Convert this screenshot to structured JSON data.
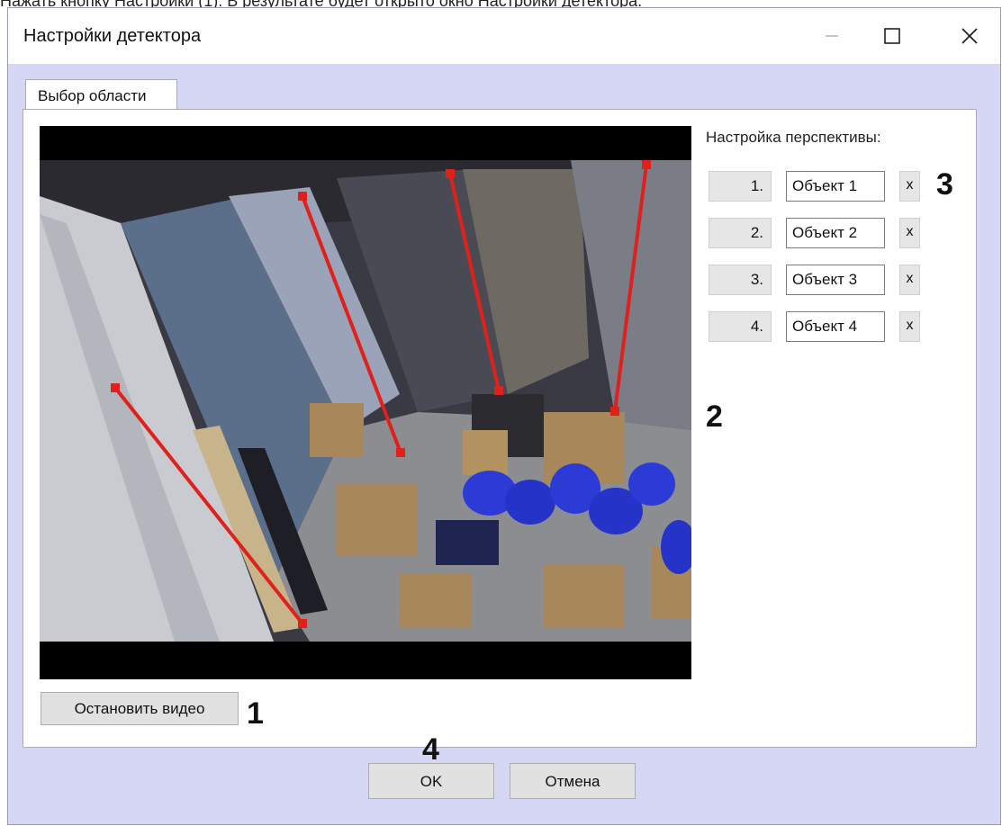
{
  "doc_text": "Нажать кнопку Настройки (1). В результате будет открыто окно Настройки детектора.",
  "window": {
    "title": "Настройки детектора"
  },
  "tab": {
    "label": "Выбор области"
  },
  "perspective": {
    "label": "Настройка перспективы:",
    "rows": [
      {
        "num": "1.",
        "name": "Объект 1",
        "delete": "x"
      },
      {
        "num": "2.",
        "name": "Объект 2",
        "delete": "x"
      },
      {
        "num": "3.",
        "name": "Объект 3",
        "delete": "x"
      },
      {
        "num": "4.",
        "name": "Объект 4",
        "delete": "x"
      }
    ]
  },
  "buttons": {
    "stop_video": "Остановить видео",
    "ok": "OK",
    "cancel": "Отмена"
  },
  "callouts": {
    "c1": "1",
    "c2": "2",
    "c3": "3",
    "c4": "4"
  },
  "colors": {
    "dialog_bg": "#d6d6f5",
    "perspective_line": "#e0201a"
  }
}
